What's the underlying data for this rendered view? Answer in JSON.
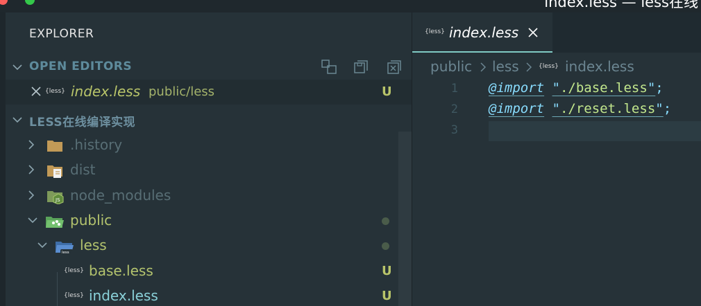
{
  "window": {
    "title": "index.less — less在线"
  },
  "explorer": {
    "title": "EXPLORER",
    "open_editors": {
      "label": "OPEN EDITORS",
      "items": [
        {
          "icon_text": "{less}",
          "filename": "index.less",
          "path": "public/less",
          "status": "U"
        }
      ]
    },
    "project": {
      "label": "LESS在线编译实现",
      "tree": [
        {
          "name": ".history",
          "icon": "folder-icon",
          "expanded": false,
          "color": "dim"
        },
        {
          "name": "dist",
          "icon": "folder-icon",
          "expanded": false,
          "color": "dim"
        },
        {
          "name": "node_modules",
          "icon": "node-folder-icon",
          "expanded": false,
          "color": "dim"
        },
        {
          "name": "public",
          "icon": "public-folder-icon",
          "expanded": true,
          "color": "olive"
        },
        {
          "name": "less",
          "icon": "less-folder-icon",
          "expanded": true,
          "color": "olive"
        },
        {
          "name": "base.less",
          "icon_text": "{less}",
          "status": "U",
          "color": "olive"
        },
        {
          "name": "index.less",
          "icon_text": "{less}",
          "status": "U",
          "color": "teal"
        }
      ]
    }
  },
  "editor": {
    "tab": {
      "icon_text": "{less}",
      "filename": "index.less"
    },
    "breadcrumbs": [
      "public",
      "less",
      "index.less"
    ],
    "breadcrumb_icon_text": "{less}",
    "lines": [
      {
        "num": "1",
        "keyword": "@import",
        "quote_open": "\"",
        "path": "./base.less",
        "quote_close": "\"",
        "semi": ";"
      },
      {
        "num": "2",
        "keyword": "@import",
        "quote_open": "\"",
        "path": "./reset.less",
        "quote_close": "\"",
        "semi": ";"
      },
      {
        "num": "3"
      }
    ]
  },
  "colors": {
    "background": "#263238",
    "accent_tab_border": "#80cbc4",
    "untracked": "#b9c56a",
    "keyword": "#89ddff",
    "string": "#c3e88d"
  }
}
